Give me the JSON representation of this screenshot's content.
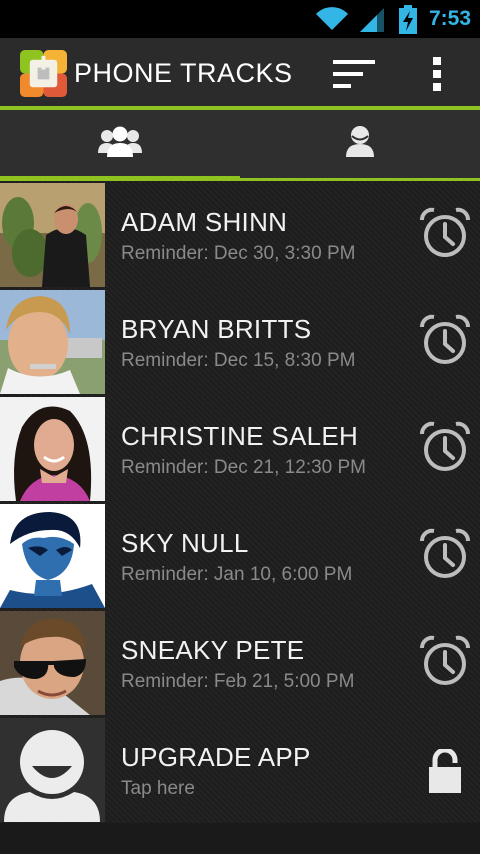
{
  "status": {
    "time": "7:53"
  },
  "app": {
    "title": "PHONE TRACKS"
  },
  "colors": {
    "accent": "#8fc31f",
    "status_blue": "#33b5e5"
  },
  "tabs": [
    {
      "icon": "group-icon",
      "selected": true
    },
    {
      "icon": "person-icon",
      "selected": false
    }
  ],
  "contacts": [
    {
      "name": "ADAM SHINN",
      "sub": "Reminder: Dec 30, 3:30 PM",
      "icon": "alarm-clock-icon"
    },
    {
      "name": "BRYAN BRITTS",
      "sub": "Reminder: Dec 15, 8:30 PM",
      "icon": "alarm-clock-icon"
    },
    {
      "name": "CHRISTINE SALEH",
      "sub": "Reminder: Dec 21, 12:30 PM",
      "icon": "alarm-clock-icon"
    },
    {
      "name": "SKY NULL",
      "sub": "Reminder: Jan 10, 6:00 PM",
      "icon": "alarm-clock-icon"
    },
    {
      "name": "SNEAKY PETE",
      "sub": "Reminder: Feb 21, 5:00 PM",
      "icon": "alarm-clock-icon"
    },
    {
      "name": "UPGRADE APP",
      "sub": "Tap here",
      "icon": "lock-icon"
    }
  ]
}
